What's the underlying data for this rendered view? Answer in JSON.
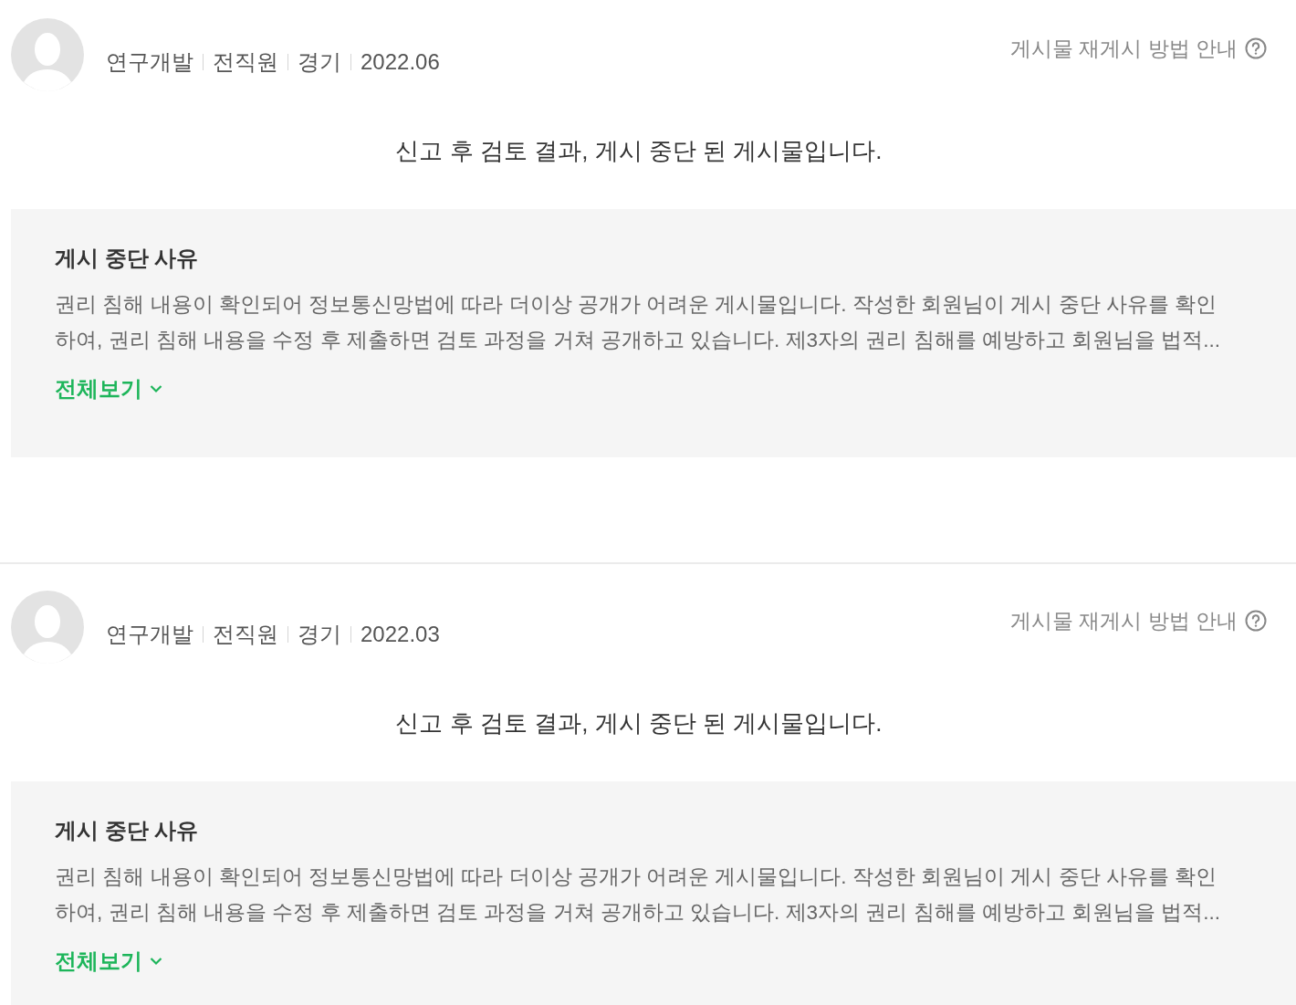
{
  "posts": [
    {
      "meta": [
        "연구개발",
        "전직원",
        "경기",
        "2022.06"
      ],
      "help_link": "게시물 재게시 방법 안내",
      "notice": "신고 후 검토 결과, 게시 중단 된 게시물입니다.",
      "reason": {
        "title": "게시 중단 사유",
        "lines": [
          "권리 침해 내용이 확인되어 정보통신망법에 따라 더이상 공개가 어려운 게시물입니다. 작성한 회원님이 게시 중단 사유를 확인",
          "하여, 권리 침해 내용을 수정 후 제출하면 검토 과정을 거쳐 공개하고 있습니다. 제3자의 권리 침해를 예방하고 회원님을 법적..."
        ],
        "more": "전체보기"
      }
    },
    {
      "meta": [
        "연구개발",
        "전직원",
        "경기",
        "2022.03"
      ],
      "help_link": "게시물 재게시 방법 안내",
      "notice": "신고 후 검토 결과, 게시 중단 된 게시물입니다.",
      "reason": {
        "title": "게시 중단 사유",
        "lines": [
          "권리 침해 내용이 확인되어 정보통신망법에 따라 더이상 공개가 어려운 게시물입니다. 작성한 회원님이 게시 중단 사유를 확인",
          "하여, 권리 침해 내용을 수정 후 제출하면 검토 과정을 거쳐 공개하고 있습니다. 제3자의 권리 침해를 예방하고 회원님을 법적..."
        ],
        "more": "전체보기"
      }
    }
  ]
}
